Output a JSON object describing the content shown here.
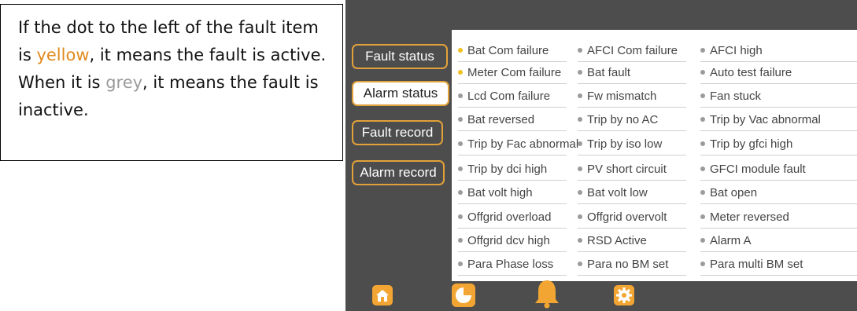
{
  "callout": {
    "text_before": "If the dot to the left of the fault item is ",
    "yellow_word": "yellow",
    "text_middle": ", it means the fault is active. When it is ",
    "grey_word": "grey",
    "text_after": ", it means the fault is inactive."
  },
  "sidebar": {
    "fault_status": "Fault status",
    "alarm_status": "Alarm status",
    "fault_record": "Fault record",
    "alarm_record": "Alarm record"
  },
  "faults": [
    [
      {
        "label": "Bat Com failure",
        "active": true
      },
      {
        "label": "AFCI Com failure",
        "active": false
      },
      {
        "label": "AFCI high",
        "active": false
      }
    ],
    [
      {
        "label": "Meter Com failure",
        "active": true
      },
      {
        "label": "Bat fault",
        "active": false
      },
      {
        "label": "Auto test failure",
        "active": false
      }
    ],
    [
      {
        "label": "Lcd Com failure",
        "active": false
      },
      {
        "label": "Fw mismatch",
        "active": false
      },
      {
        "label": "Fan stuck",
        "active": false
      }
    ],
    [
      {
        "label": "Bat reversed",
        "active": false
      },
      {
        "label": "Trip by no AC",
        "active": false
      },
      {
        "label": "Trip by Vac abnormal",
        "active": false
      }
    ],
    [
      {
        "label": "Trip by Fac abnormal",
        "active": false
      },
      {
        "label": "Trip by iso low",
        "active": false
      },
      {
        "label": "Trip by gfci high",
        "active": false
      }
    ],
    [
      {
        "label": "Trip by dci high",
        "active": false
      },
      {
        "label": "PV short circuit",
        "active": false
      },
      {
        "label": "GFCI module fault",
        "active": false
      }
    ],
    [
      {
        "label": "Bat volt high",
        "active": false
      },
      {
        "label": "Bat volt low",
        "active": false
      },
      {
        "label": "Bat open",
        "active": false
      }
    ],
    [
      {
        "label": "Offgrid overload",
        "active": false
      },
      {
        "label": "Offgrid overvolt",
        "active": false
      },
      {
        "label": "Meter reversed",
        "active": false
      }
    ],
    [
      {
        "label": "Offgrid dcv high",
        "active": false
      },
      {
        "label": "RSD Active",
        "active": false
      },
      {
        "label": "Alarm A",
        "active": false
      }
    ],
    [
      {
        "label": "Para Phase loss",
        "active": false
      },
      {
        "label": "Para no BM set",
        "active": false
      },
      {
        "label": "Para multi BM set",
        "active": false
      }
    ]
  ],
  "bottom_nav": [
    "home-icon",
    "pie-chart-icon",
    "bell-icon",
    "gear-icon"
  ],
  "colors": {
    "accent": "#e2a13a",
    "active_dot": "#f0c020",
    "inactive_dot": "#9b9b9b",
    "screen_bg": "#4d4d4d"
  }
}
